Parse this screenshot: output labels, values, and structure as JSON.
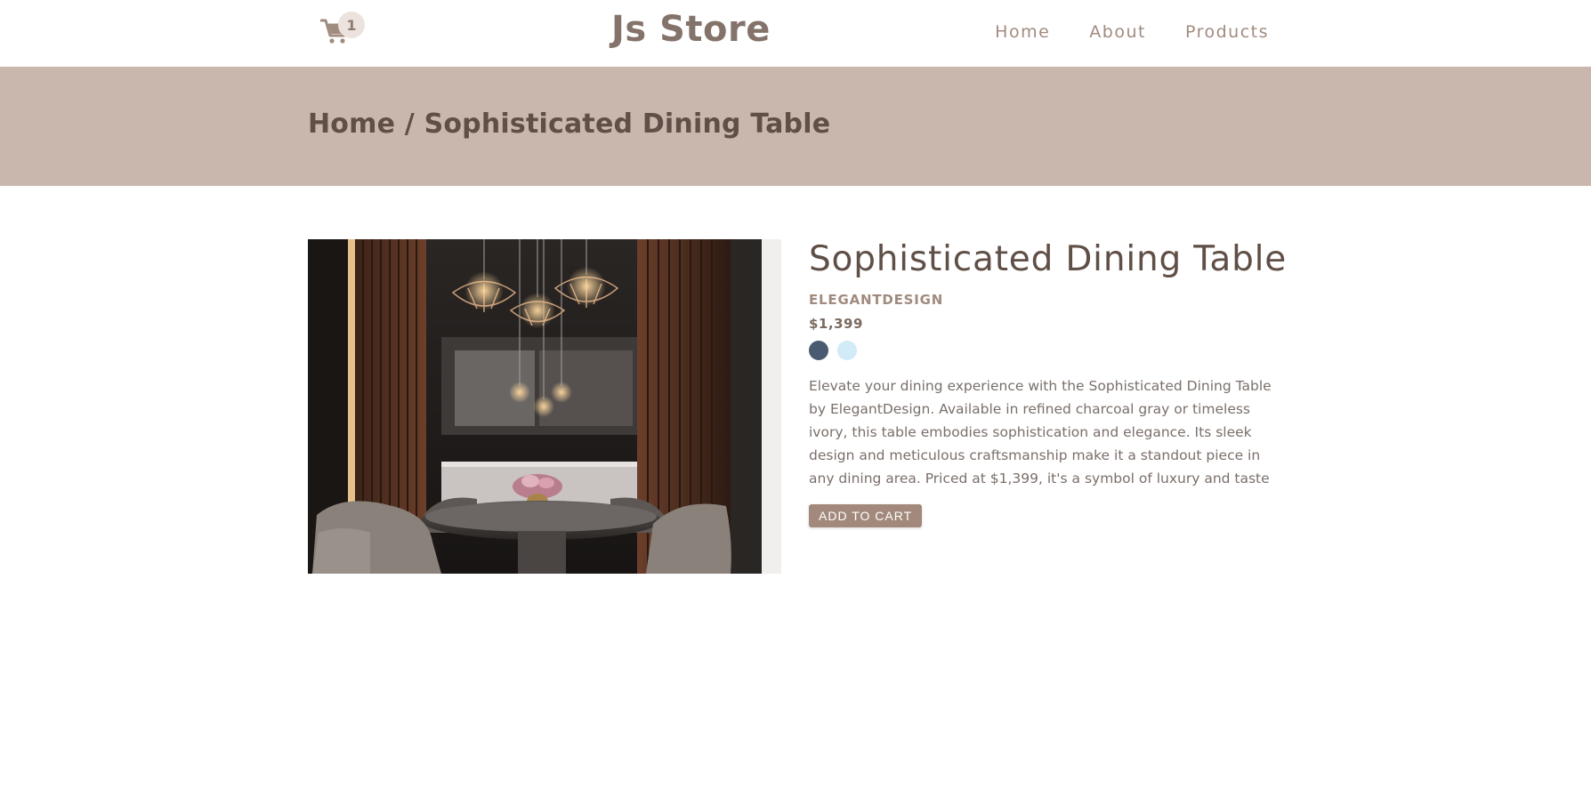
{
  "navbar": {
    "cart_count": "1",
    "logo": "Js Store",
    "links": [
      "Home",
      "About",
      "Products"
    ]
  },
  "hero": {
    "breadcrumb": "Home / Sophisticated Dining Table"
  },
  "product": {
    "image_subject": "dining room with round table, chairs and pendant lamps",
    "title": "Sophisticated Dining Table",
    "company": "ELEGANTDESIGN",
    "price": "$1,399",
    "colors": [
      "#4a5a70",
      "#d1ebf7"
    ],
    "description": "Elevate your dining experience with the Sophisticated Dining Table by ElegantDesign. Available in refined charcoal gray or timeless ivory, this table embodies sophistication and elegance. Its sleek design and meticulous craftsmanship make it a standout piece in any dining area. Priced at $1,399, it's a symbol of luxury and taste",
    "add_to_cart_label": "ADD TO CART"
  },
  "colors": {
    "brand": "#a3897b",
    "hero_bg": "#c9b6ac",
    "text_dark": "#5f4f46"
  }
}
